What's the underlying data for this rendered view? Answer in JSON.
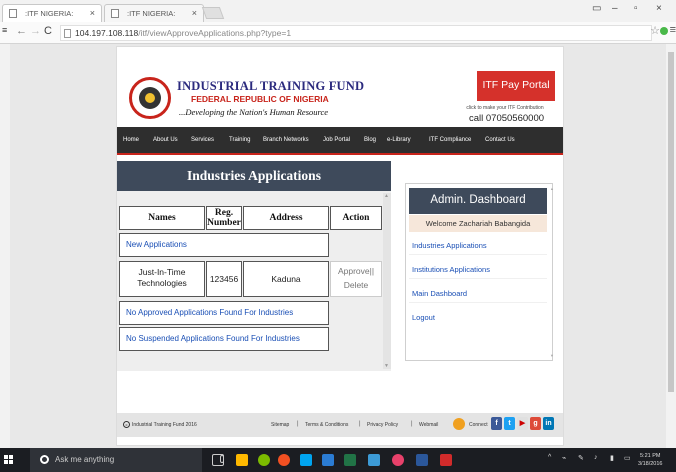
{
  "browser": {
    "tabs": [
      {
        "label": ":ITF NIGERIA:"
      },
      {
        "label": ":ITF NIGERIA:"
      }
    ],
    "address_host": "104.197.108.118",
    "address_path": "/itf/viewApproveApplications.php?type=1"
  },
  "header": {
    "org_title": "INDUSTRIAL TRAINING FUND",
    "org_subtitle": "FEDERAL REPUBLIC OF NIGERIA",
    "motto": "...Developing the Nation's Human Resource",
    "pay_portal_label": "ITF Pay Portal",
    "pay_note": "click to make your ITF Contribution",
    "call": "call 07050560000"
  },
  "nav": {
    "items": [
      "Home",
      "About Us",
      "Services",
      "Training",
      "Branch Networks",
      "Job Portal",
      "Blog",
      "e-Library",
      "ITF Compliance",
      "Contact Us"
    ]
  },
  "applications": {
    "title": "Industries Applications",
    "columns": [
      "Names",
      "Reg. Number",
      "Address",
      "Action"
    ],
    "new_label": "New Applications",
    "row": {
      "name": "Just-In-Time Technologies",
      "reg": "123456",
      "address": "Kaduna",
      "approve": "Approve||",
      "delete": "Delete"
    },
    "no_approved": "No Approved Applications Found For Industries",
    "no_suspended": "No Suspended Applications Found For Industries"
  },
  "admin": {
    "title": "Admin. Dashboard",
    "welcome": "Welcome Zachariah Babangida",
    "links": [
      "Industries Applications",
      "Institutions Applications",
      "Main Dashboard",
      "Logout"
    ]
  },
  "footer": {
    "copyright": "Industrial Training Fund 2016",
    "links": [
      "Sitemap",
      "Terms & Conditions",
      "Privacy Policy",
      "Webmail"
    ],
    "connect": "Connect"
  },
  "taskbar": {
    "search_placeholder": "Ask me anything",
    "time": "5:21 PM",
    "date": "3/18/2016"
  },
  "colors": {
    "brand_red": "#c8241b",
    "brand_navy": "#2b2a7e",
    "panel_head": "#3e4a5b",
    "nav_bg": "#2e2e2e",
    "link_blue": "#1a4fb5"
  }
}
